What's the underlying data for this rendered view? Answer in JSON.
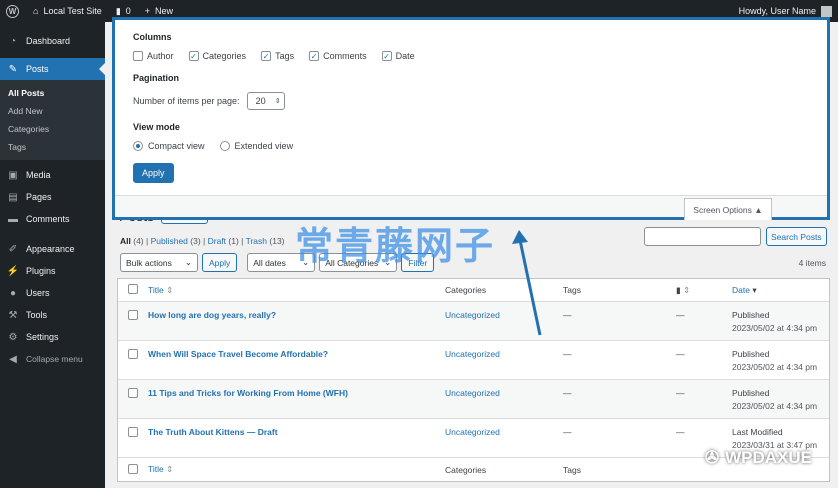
{
  "adminbar": {
    "site_name": "Local Test Site",
    "comments_count": "0",
    "new_label": "New",
    "howdy": "Howdy, User Name"
  },
  "sidebar": {
    "items": [
      {
        "label": "Dashboard",
        "icon": "dashboard-icon"
      },
      {
        "label": "Posts",
        "icon": "pin-icon"
      },
      {
        "label": "Media",
        "icon": "media-icon"
      },
      {
        "label": "Pages",
        "icon": "pages-icon"
      },
      {
        "label": "Comments",
        "icon": "comments-icon"
      },
      {
        "label": "Appearance",
        "icon": "appearance-icon"
      },
      {
        "label": "Plugins",
        "icon": "plugins-icon"
      },
      {
        "label": "Users",
        "icon": "users-icon"
      },
      {
        "label": "Tools",
        "icon": "tools-icon"
      },
      {
        "label": "Settings",
        "icon": "settings-icon"
      }
    ],
    "submenu": [
      "All Posts",
      "Add New",
      "Categories",
      "Tags"
    ],
    "collapse": "Collapse menu"
  },
  "screen_options": {
    "columns_heading": "Columns",
    "columns": [
      {
        "label": "Author",
        "checked": false
      },
      {
        "label": "Categories",
        "checked": true
      },
      {
        "label": "Tags",
        "checked": true
      },
      {
        "label": "Comments",
        "checked": true
      },
      {
        "label": "Date",
        "checked": true
      }
    ],
    "pagination_heading": "Pagination",
    "per_page_label": "Number of items per page:",
    "per_page_value": "20",
    "view_mode_heading": "View mode",
    "compact_label": "Compact view",
    "extended_label": "Extended view",
    "apply_label": "Apply",
    "tab_label": "Screen Options"
  },
  "page": {
    "title": "Posts",
    "add_new": "Add New",
    "filters": {
      "all": "All",
      "all_count": "(4)",
      "published": "Published",
      "published_count": "(3)",
      "draft": "Draft",
      "draft_count": "(1)",
      "trash": "Trash",
      "trash_count": "(13)"
    },
    "search_button": "Search Posts",
    "bulk_actions": "Bulk actions",
    "apply": "Apply",
    "all_dates": "All dates",
    "all_categories": "All Categories",
    "filter": "Filter",
    "items_count": "4 items"
  },
  "table": {
    "headers": {
      "title": "Title",
      "categories": "Categories",
      "tags": "Tags",
      "date": "Date"
    },
    "rows": [
      {
        "title": "How long are dog years, really?",
        "category": "Uncategorized",
        "tags": "—",
        "comments": "—",
        "status": "Published",
        "date": "2023/05/02 at 4:34 pm"
      },
      {
        "title": "When Will Space Travel Become Affordable?",
        "category": "Uncategorized",
        "tags": "—",
        "comments": "—",
        "status": "Published",
        "date": "2023/05/02 at 4:34 pm"
      },
      {
        "title": "11 Tips and Tricks for Working From Home (WFH)",
        "category": "Uncategorized",
        "tags": "—",
        "comments": "—",
        "status": "Published",
        "date": "2023/05/02 at 4:34 pm"
      },
      {
        "title": "The Truth About Kittens — Draft",
        "category": "Uncategorized",
        "tags": "—",
        "comments": "—",
        "status": "Last Modified",
        "date": "2023/03/31 at 3:47 pm"
      }
    ]
  },
  "watermark": "常青藤网子",
  "wechat_mark": "WPDAXUE",
  "colors": {
    "accent": "#2271b1",
    "sidebar": "#1d2327"
  }
}
